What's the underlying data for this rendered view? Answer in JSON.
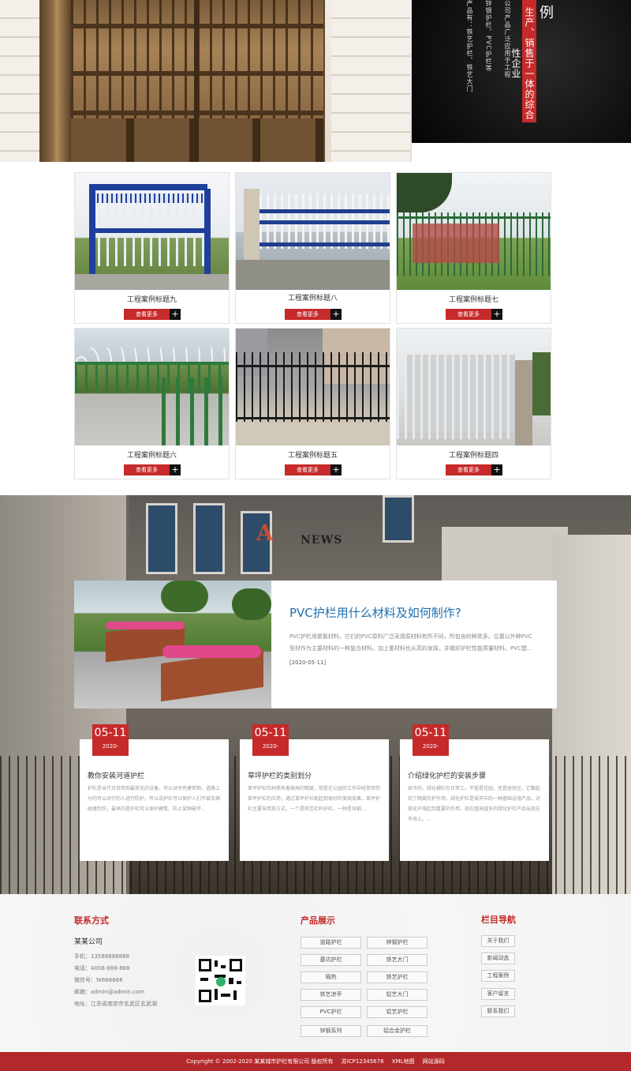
{
  "hero": {
    "tagline": "生产、销售于一体的综合性企业",
    "vertical_lines": [
      "产品有：铁艺护栏、铁艺大门",
      "锌钢护栏、PVC护栏等",
      "公司产品广泛应用于工程"
    ],
    "big_char": "例"
  },
  "cases": {
    "button_label": "查看更多",
    "plus": "+",
    "items": [
      {
        "title": "工程案例标题九"
      },
      {
        "title": "工程案例标题八"
      },
      {
        "title": "工程案例标题七"
      },
      {
        "title": "工程案例标题六"
      },
      {
        "title": "工程案例标题五"
      },
      {
        "title": "工程案例标题四"
      }
    ]
  },
  "news": {
    "watermark_a": "A",
    "watermark_word": "NEWS",
    "feature": {
      "title": "PVC护栏用什么材料及如何制作?",
      "summary": "PVC护栏用聚氯材料。它们的PVC原料广泛采用原材料有所不同，所包含的种类多。位置以外种PVC型材作为主要材料的一种复合材料。加上重材料也从高的发挥，并做好护栏性能质量材料。PVC塑...",
      "date": "[2020-05-11]"
    },
    "cards": [
      {
        "md": "05-11",
        "year": "2020-",
        "title": "教你安装河道护栏",
        "text": "护栏是当代日常用到最常见的设备，可以对所有建筑物，道路上分的可以对行的人进行防护，所以说护栏可以保护人们不被车辆碰撞到伤，最早的是护栏可以保护建筑，防止某种破坏..."
      },
      {
        "md": "05-11",
        "year": "2020-",
        "title": "草坪护栏的类别划分",
        "text": "草坪护栏的材质有着很高的精度，但是在公园的工作中经常用到草坪护栏的应用，通过草坪护栏能起到很好的美观效果。草坪护栏主要采用其方式，一个是铁艺栏杆护栏，一种是锌钢..."
      },
      {
        "md": "05-11",
        "year": "2020-",
        "title": "介绍绿化护栏的安装步骤",
        "text": "如今的，绿化栅栏在日常工，不管是花园，还是居民区，它都起到了隔离防护作用。绿化护栏是城市中的一种基础设施产品，对美化环境起到重要的作用，现在越来越多的绿化护栏产品出现在市场上。..."
      }
    ]
  },
  "footer": {
    "contact_heading": "联系方式",
    "company": "某某公司",
    "lines": [
      "手机：13588888888",
      "电话：4008-888-888",
      "微信号：W666666",
      "邮箱：admin@admin.com",
      "地址：江苏省南京市玄武区玄武湖"
    ],
    "products_heading": "产品展示",
    "products": [
      "道路护栏",
      "锌钢护栏",
      "基坑护栏",
      "铁艺大门",
      "隔热",
      "铁艺护栏",
      "铁艺凉亭",
      "铝艺大门",
      "PVC护栏",
      "铝艺护栏",
      "锌钢系列",
      "铝合金护栏"
    ],
    "nav_heading": "栏目导航",
    "nav": [
      "关于我们",
      "新闻动态",
      "工程案例",
      "客户留言",
      "联系我们"
    ]
  },
  "copyright": {
    "text": "Copyright © 2002-2020 某某城市护栏有限公司 版权所有",
    "icp": "苏ICP12345678",
    "xml": "XML地图",
    "source": "网站源码"
  },
  "colors": {
    "accent": "#c62a2a",
    "link": "#1f6fae"
  }
}
